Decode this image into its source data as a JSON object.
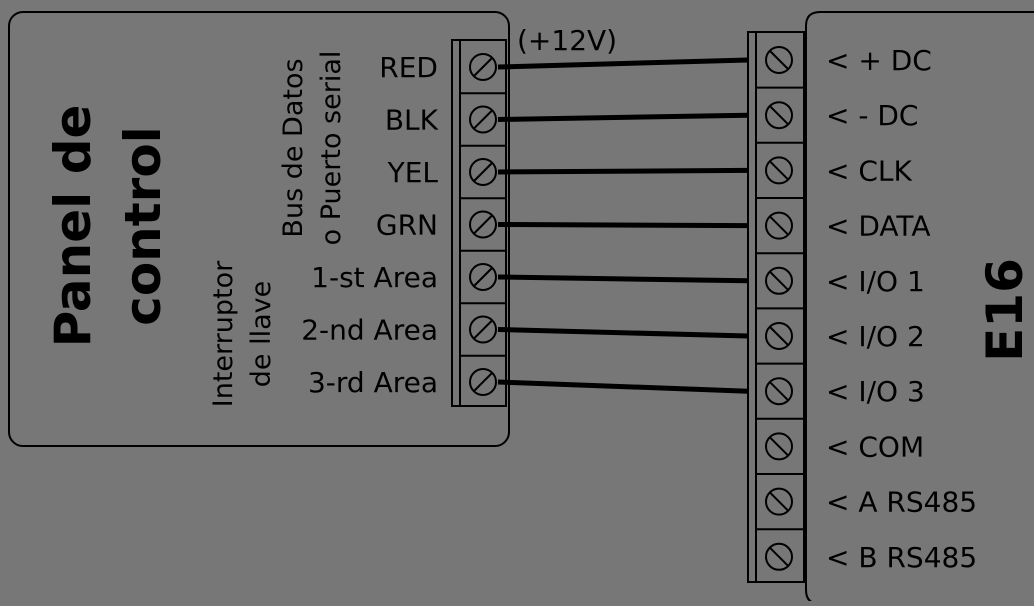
{
  "panel": {
    "title_line1": "Panel de",
    "title_line2": "control",
    "bus_line1": "Bus de Datos",
    "bus_line2": "o Puerto serial",
    "key_line1": "Interruptor",
    "key_line2": "de llave",
    "terminals": [
      "RED",
      "BLK",
      "YEL",
      "GRN",
      "1-st Area",
      "2-nd Area",
      "3-rd Area"
    ]
  },
  "voltage_label": "(+12V)",
  "device": {
    "name": "E16",
    "terminals": [
      "< + DC",
      "< - DC",
      "< CLK",
      "< DATA",
      "< I/O 1",
      "< I/O 2",
      "< I/O 3",
      "< COM",
      "< A RS485",
      "< B RS485"
    ]
  },
  "colors": {
    "background": "#777777",
    "line": "#000000"
  }
}
